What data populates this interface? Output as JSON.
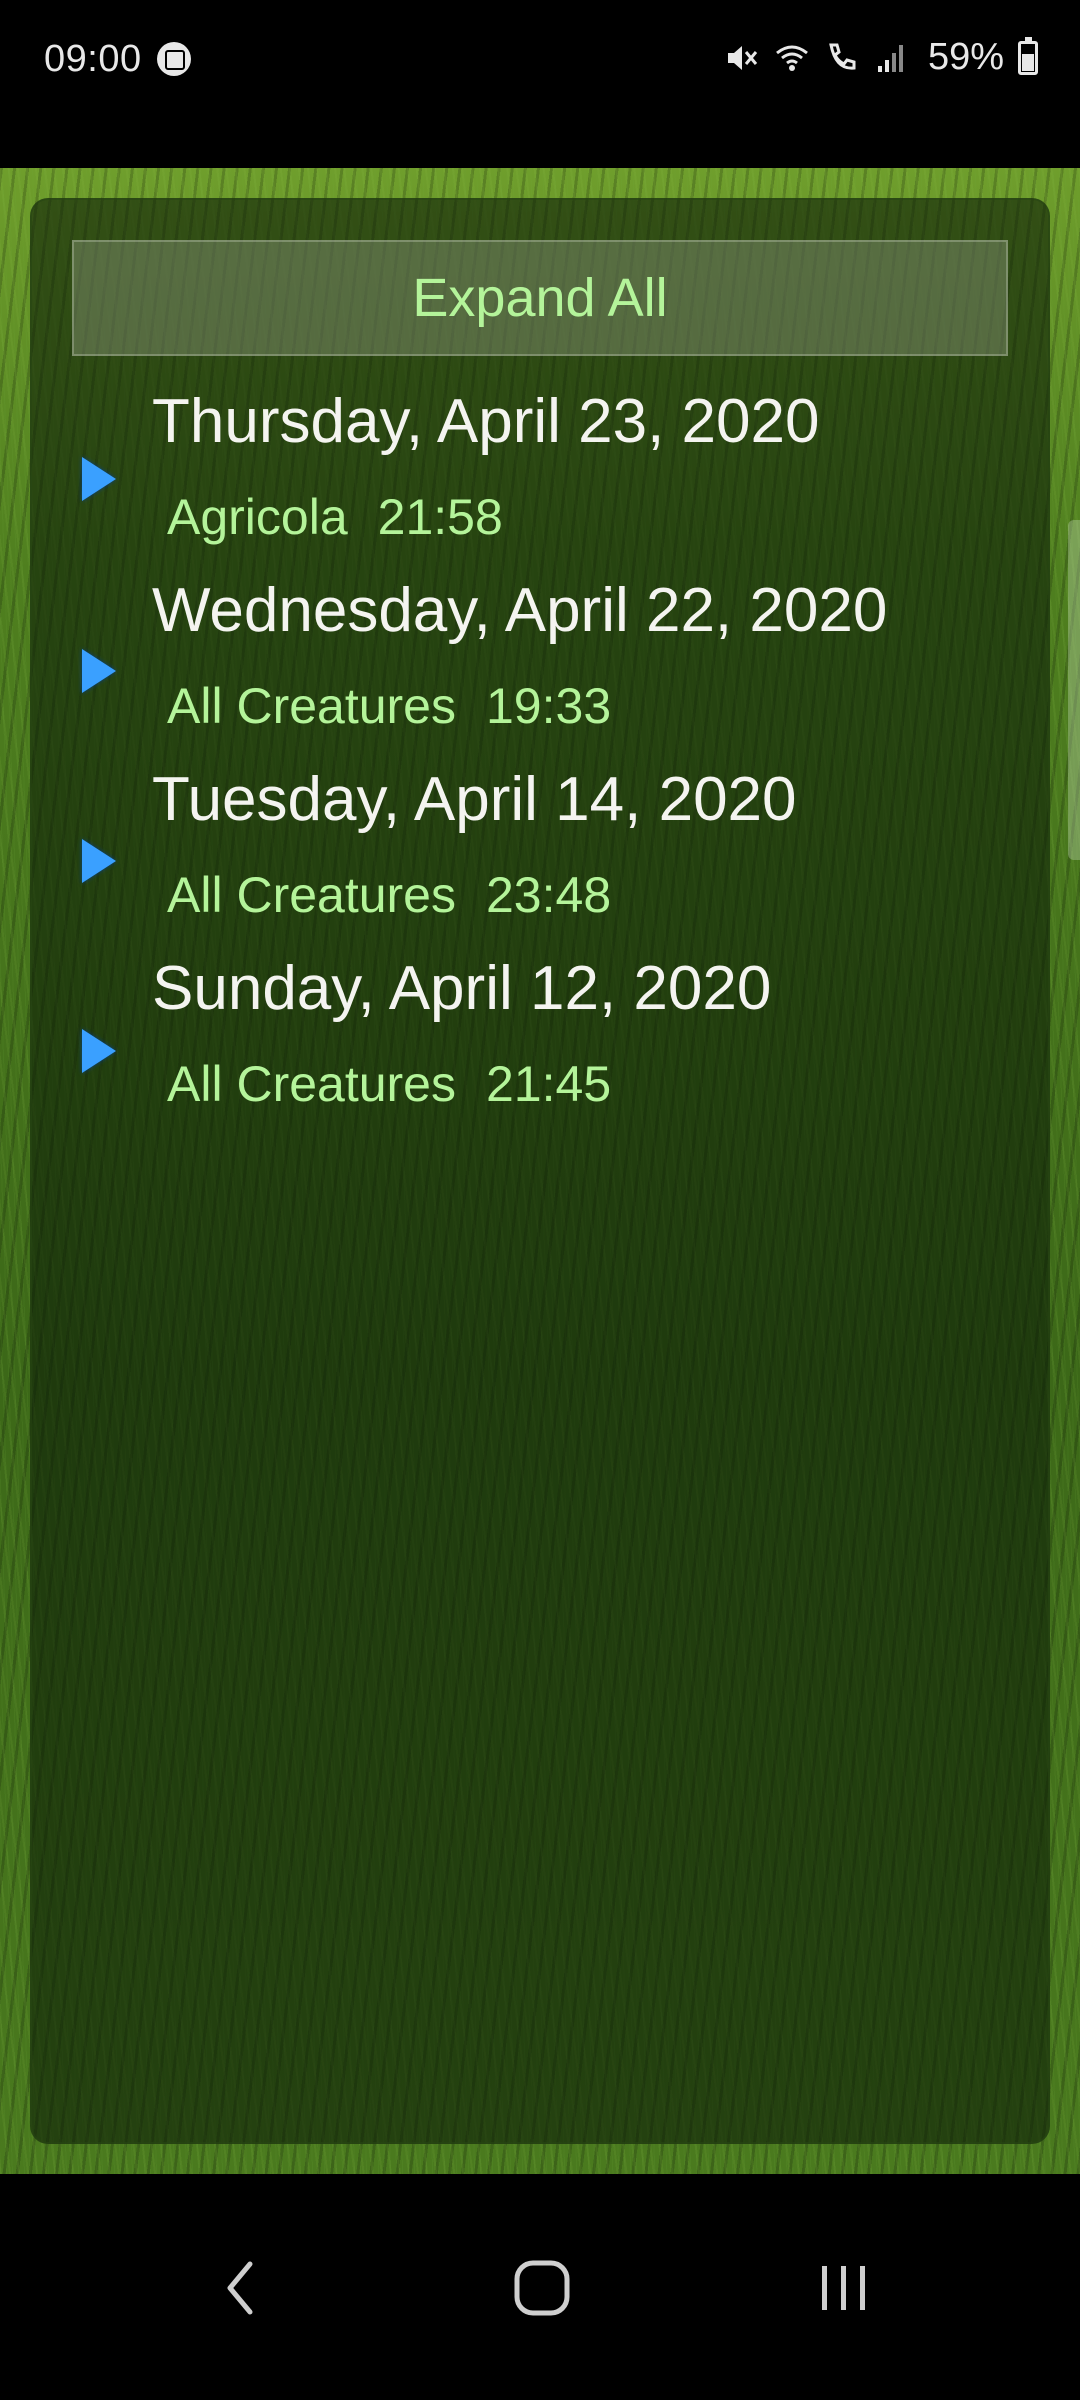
{
  "status_bar": {
    "time": "09:00",
    "battery_percent": "59%",
    "battery_level": 0.59,
    "icons": [
      "app-notification-icon",
      "mute-icon",
      "wifi-icon",
      "wifi-calling-icon",
      "signal-icon",
      "battery-icon"
    ]
  },
  "main": {
    "expand_all_label": "Expand All",
    "groups": [
      {
        "date": "Thursday, April 23, 2020",
        "game": "Agricola",
        "time": "21:58"
      },
      {
        "date": "Wednesday, April 22, 2020",
        "game": "All Creatures",
        "time": "19:33"
      },
      {
        "date": "Tuesday, April 14, 2020",
        "game": "All Creatures",
        "time": "23:48"
      },
      {
        "date": "Sunday, April 12, 2020",
        "game": "All Creatures",
        "time": "21:45"
      }
    ]
  },
  "nav_bar": {
    "buttons": [
      "back-icon",
      "home-icon",
      "recents-icon"
    ]
  },
  "colors": {
    "accent_text": "#b4f49a",
    "arrow": "#3aa0ff",
    "date_text": "#f4f4f0"
  }
}
